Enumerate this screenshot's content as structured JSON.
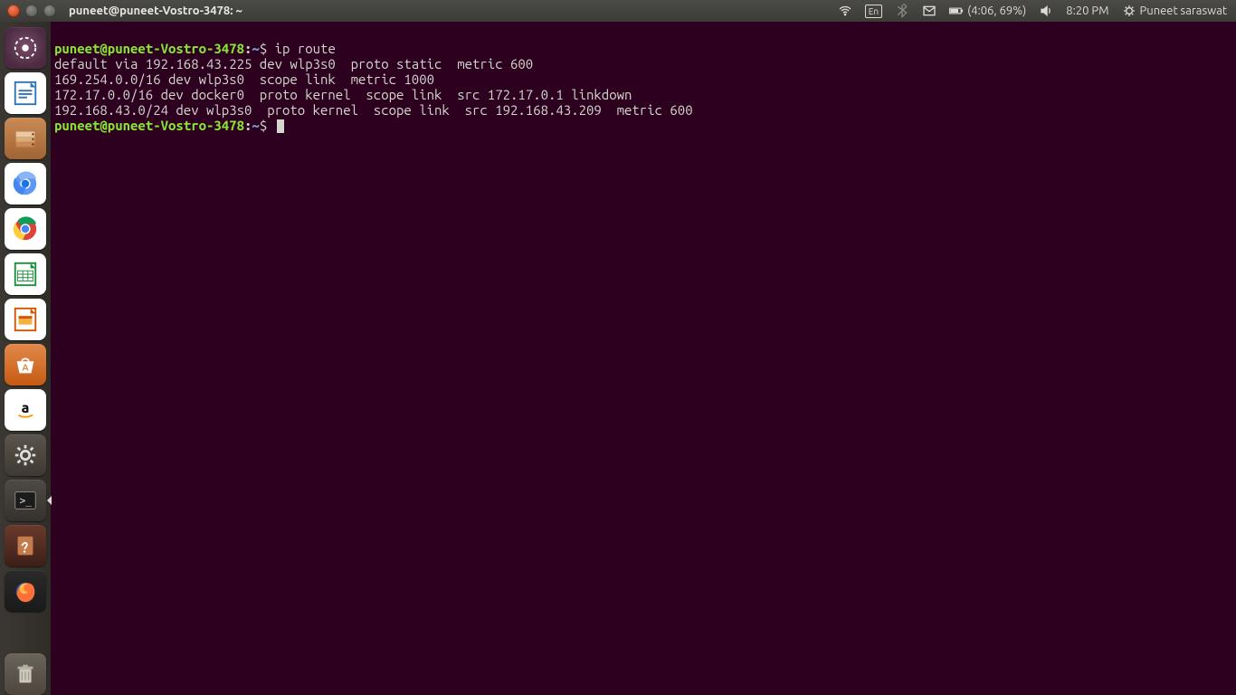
{
  "menubar": {
    "title": "puneet@puneet-Vostro-3478: ~",
    "lang": "En",
    "battery": "(4:06, 69%)",
    "time": "8:20 PM",
    "user": "Puneet saraswat"
  },
  "launcher": {
    "items": [
      {
        "name": "dash"
      },
      {
        "name": "writer"
      },
      {
        "name": "files"
      },
      {
        "name": "chromium"
      },
      {
        "name": "chrome"
      },
      {
        "name": "calc"
      },
      {
        "name": "impress"
      },
      {
        "name": "software"
      },
      {
        "name": "amazon"
      },
      {
        "name": "settings"
      },
      {
        "name": "terminal"
      },
      {
        "name": "devhelp"
      },
      {
        "name": "firefox"
      }
    ]
  },
  "terminal": {
    "prompt_user": "puneet@puneet-Vostro-3478",
    "prompt_path": "~",
    "prompt_symbol": "$",
    "cmd1": "ip route",
    "output": [
      "default via 192.168.43.225 dev wlp3s0  proto static  metric 600",
      "169.254.0.0/16 dev wlp3s0  scope link  metric 1000",
      "172.17.0.0/16 dev docker0  proto kernel  scope link  src 172.17.0.1 linkdown",
      "192.168.43.0/24 dev wlp3s0  proto kernel  scope link  src 192.168.43.209  metric 600"
    ]
  }
}
